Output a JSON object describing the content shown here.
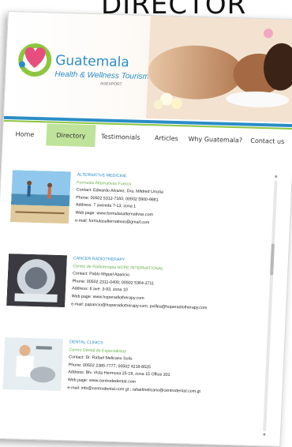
{
  "background_title": "DIRECTOR",
  "brand": {
    "name": "Guatemala",
    "tagline": "Health & Wellness Tourism",
    "sub": "AGEXPORT"
  },
  "nav": {
    "items": [
      "Home",
      "Directory",
      "Testimonials",
      "Articles",
      "Why Guatemala?",
      "Contact us"
    ],
    "active": "Directory"
  },
  "entries": [
    {
      "category": "ALTERNATIVE MEDICINE",
      "org": "Formulas Alternativas Fuerza",
      "contact": "Contact: Edwardo Alvarez, Dra. Mildred Urrutia",
      "phone": "Phone: 00502 5312-7160; 00502 5900-9881",
      "address": "Address: 7 avenida 7-13, zona 1",
      "web": "Web page: www.formulasalternativas.com",
      "email": "e-mail: formulasalternativas@gmail.com"
    },
    {
      "category": "CANCER RADIOTHERAPY",
      "org": "Centro de Radioterapia HOPE INTERNATIONAL",
      "contact": "Contact: Pablo Miguel Aparicio",
      "phone": "Phone: 00502 2311-0400; 00502 5364-3711",
      "address": "Address: 6 ave. 3-93, zona 10",
      "web": "Web page: www.hoperadiotherapy.com",
      "email": "e-mail: paparicio@hoperadiotherapy.com; pvillea@hoperadiotherapy.com"
    },
    {
      "category": "DENTAL CLINICS",
      "org": "Centro Dental de Especialistas",
      "contact": "Contact: Dr. Rafael Melicano Solis",
      "phone": "Phone: 00502 2385-7777; 00502 4218-8525",
      "address": "Address: Blv. Vista Hermosa 25-19, zona 15 Office 301",
      "web": "Web page: www.centrodedental.com",
      "email": "e-mail: info@centrodental.com.gt ; rafaelmelicano@centrodental.com.gt"
    }
  ],
  "colors": {
    "accent_blue": "#2a8dc6",
    "accent_green": "#8cc63f",
    "active_nav": "#bfe39a"
  }
}
